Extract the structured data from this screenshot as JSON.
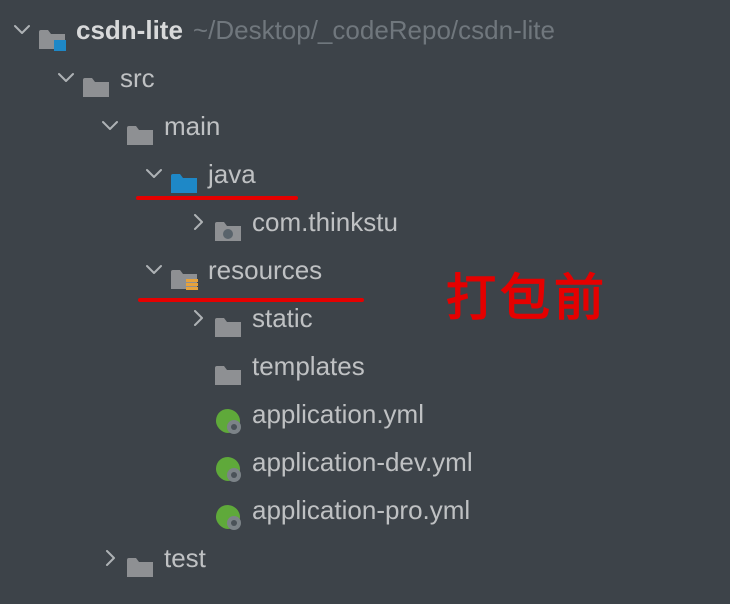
{
  "project": {
    "name": "csdn-lite",
    "path": "~/Desktop/_codeRepo/csdn-lite"
  },
  "tree": {
    "src": "src",
    "main": "main",
    "java": "java",
    "package": "com.thinkstu",
    "resources": "resources",
    "static": "static",
    "templates": "templates",
    "app_yml": "application.yml",
    "app_dev": "application-dev.yml",
    "app_pro": "application-pro.yml",
    "test": "test"
  },
  "annotation": {
    "label": "打包前"
  }
}
